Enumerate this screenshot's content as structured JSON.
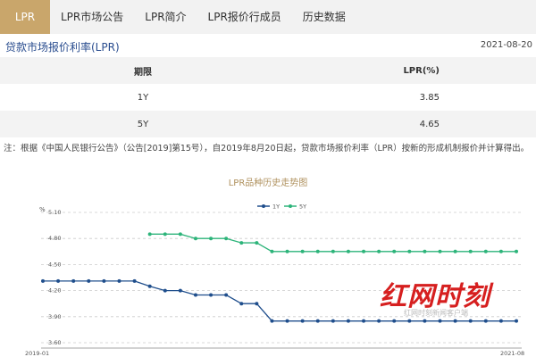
{
  "tabs": [
    {
      "label": "LPR"
    },
    {
      "label": "LPR市场公告"
    },
    {
      "label": "LPR简介"
    },
    {
      "label": "LPR报价行成员"
    },
    {
      "label": "历史数据"
    }
  ],
  "section": {
    "title": "贷款市场报价利率(LPR)",
    "date": "2021-08-20"
  },
  "table": {
    "headers": [
      "期限",
      "LPR(%)"
    ],
    "rows": [
      {
        "term": "1Y",
        "rate": "3.85"
      },
      {
        "term": "5Y",
        "rate": "4.65"
      }
    ]
  },
  "note": "注：根据《中国人民银行公告》（公告[2019]第15号），自2019年8月20日起，贷款市场报价利率（LPR）按新的形成机制报价并计算得出。",
  "chart_data": {
    "type": "line",
    "title": "LPR品种历史走势图",
    "ylabel": "%",
    "ylim": [
      3.6,
      5.1
    ],
    "yticks": [
      "5.10",
      "4.80",
      "4.50",
      "4.20",
      "3.90",
      "3.60"
    ],
    "x_start_label": "2019-01",
    "x_end_label": "2021-08",
    "legend_position": "top-center",
    "series": [
      {
        "name": "1Y",
        "color": "#1f4e8c",
        "values": [
          4.31,
          4.31,
          4.31,
          4.31,
          4.31,
          4.31,
          4.31,
          4.25,
          4.2,
          4.2,
          4.15,
          4.15,
          4.15,
          4.05,
          4.05,
          3.85,
          3.85,
          3.85,
          3.85,
          3.85,
          3.85,
          3.85,
          3.85,
          3.85,
          3.85,
          3.85,
          3.85,
          3.85,
          3.85,
          3.85,
          3.85,
          3.85
        ]
      },
      {
        "name": "5Y",
        "color": "#2db47a",
        "values": [
          null,
          null,
          null,
          null,
          null,
          null,
          null,
          4.85,
          4.85,
          4.85,
          4.8,
          4.8,
          4.8,
          4.75,
          4.75,
          4.65,
          4.65,
          4.65,
          4.65,
          4.65,
          4.65,
          4.65,
          4.65,
          4.65,
          4.65,
          4.65,
          4.65,
          4.65,
          4.65,
          4.65,
          4.65,
          4.65
        ]
      }
    ]
  },
  "watermark": {
    "logo_text": "红网时刻",
    "sub_text": "红网时刻新闻客户端"
  }
}
